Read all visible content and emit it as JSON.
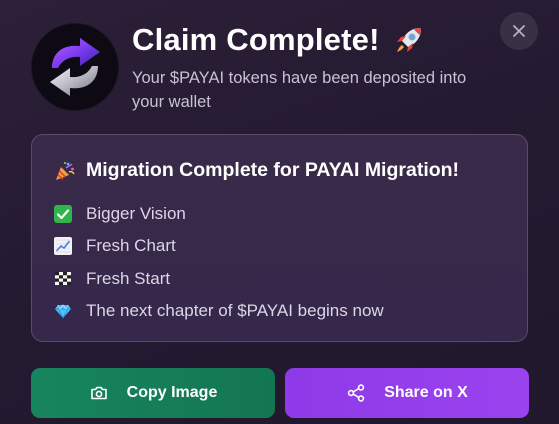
{
  "dialog": {
    "title": "Claim Complete!",
    "title_emoji_icon": "rocket-icon",
    "subtitle": "Your $PAYAI tokens have been deposited into your wallet",
    "logo_icon": "migration-arrows-logo",
    "close_icon": "close-icon"
  },
  "card": {
    "title": "Migration Complete for PAYAI Migration!",
    "title_icon": "party-popper-icon",
    "items": [
      {
        "icon": "check-mark-icon",
        "label": "Bigger Vision"
      },
      {
        "icon": "chart-increasing-icon",
        "label": "Fresh Chart"
      },
      {
        "icon": "checkered-flag-icon",
        "label": "Fresh Start"
      },
      {
        "icon": "gem-icon",
        "label": "The next chapter of $PAYAI begins now"
      }
    ]
  },
  "buttons": {
    "copy_image": {
      "label": "Copy Image",
      "icon": "camera-icon"
    },
    "share": {
      "label": "Share on X",
      "icon": "share-icon"
    }
  },
  "colors": {
    "background": "#241a31",
    "card_background": "#372849",
    "card_border": "#5c4a6c",
    "copy_button": "#15805a",
    "share_button": "#9540ec",
    "subtitle_text": "#c9c1d4"
  }
}
